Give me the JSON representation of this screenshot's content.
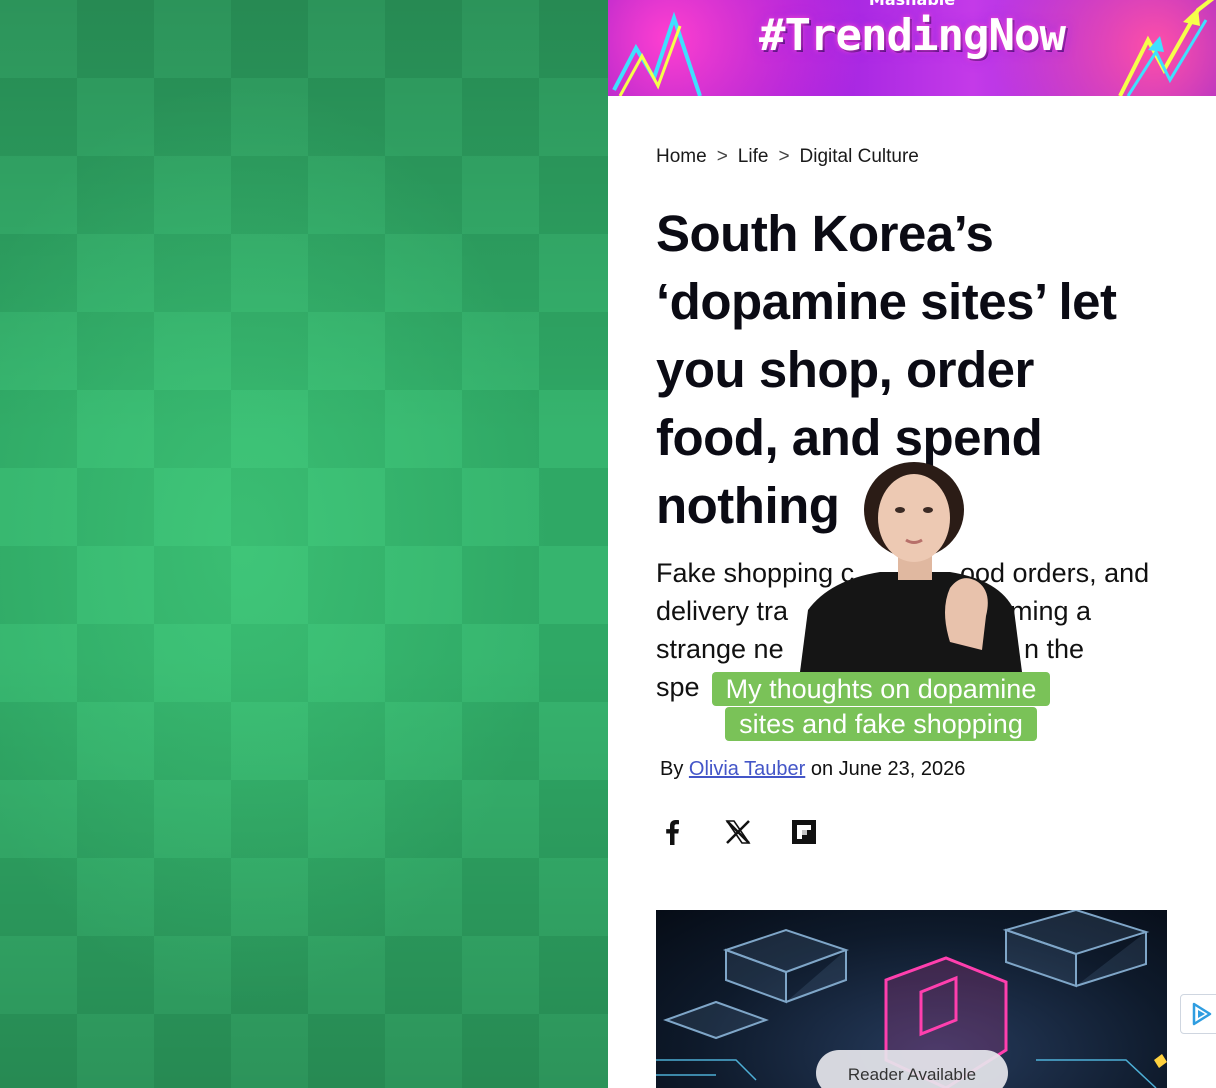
{
  "banner": {
    "brand": "Mashable",
    "hashtag": "#TrendingNow"
  },
  "breadcrumb": [
    "Home",
    "Life",
    "Digital Culture"
  ],
  "breadcrumb_separator": ">",
  "article": {
    "headline_lines": [
      "South Korea’s",
      "‘dopamine sites’ let",
      "you shop, order",
      "food, and spend",
      "nothing"
    ],
    "dek_lines": [
      "Fake shopping c",
      "ood orders, and",
      "delivery tra",
      "ming a",
      "strange ne",
      "n the",
      "spe"
    ],
    "byline_prefix": "By",
    "author": "Olivia Tauber",
    "date_text": "on June 23, 2026"
  },
  "share_icons": [
    "facebook-icon",
    "x-icon",
    "flipboard-icon"
  ],
  "video_overlay": {
    "caption_lines": [
      "My thoughts on dopamine",
      "sites and fake shopping"
    ]
  },
  "reader_pill": "Reader Available",
  "colors": {
    "checker_green": "#36b46e",
    "caption_green": "#7ac258",
    "author_link": "#4456c8",
    "banner_purple": "#9b1fe0"
  }
}
